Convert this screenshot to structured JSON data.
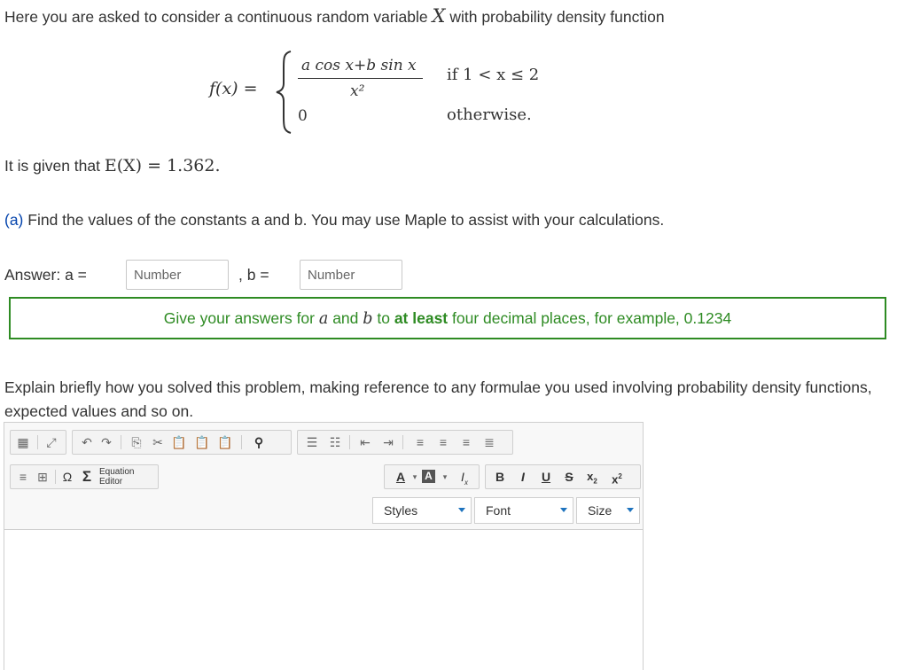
{
  "question": {
    "intro_text": "Here you are asked to consider a continuous random variable",
    "intro_var": "X",
    "intro_suffix": "with probability density function",
    "pdf": {
      "lhs": "f(x) =",
      "numerator": "a cos x+b sin x",
      "denominator": "x²",
      "case1_value": "0",
      "case1_condition": "if  1 < x ≤ 2",
      "case2_condition": "otherwise."
    },
    "given_prefix": "It is given that",
    "given_expr": "E(X) = 1.362.",
    "part_a_label": "(a)",
    "part_a_text": "Find the values of the constants a and b. You may use Maple to assist with your calculations."
  },
  "answer": {
    "label_a": "Answer: a =",
    "input_a_placeholder": "Number",
    "input_a_value": "",
    "label_b": ", b =",
    "input_b_placeholder": "Number",
    "input_b_value": ""
  },
  "hint": {
    "prefix": "Give your answers for",
    "var_a": "a",
    "and": "and",
    "var_b": "b",
    "to": "to",
    "bold": "at least",
    "suffix": "four decimal places, for example, 0.1234"
  },
  "explain_text": "Explain briefly how you solved this problem, making reference to any formulae you used involving probability density functions, expected values and so on.",
  "editor": {
    "equation_editor_label_1": "Equation",
    "equation_editor_label_2": "Editor",
    "styles_label": "Styles",
    "font_label": "Font",
    "size_label": "Size",
    "colors": {
      "accent": "#1e73be",
      "hint_green": "#2e8b23",
      "link_blue": "#0645ad"
    }
  }
}
